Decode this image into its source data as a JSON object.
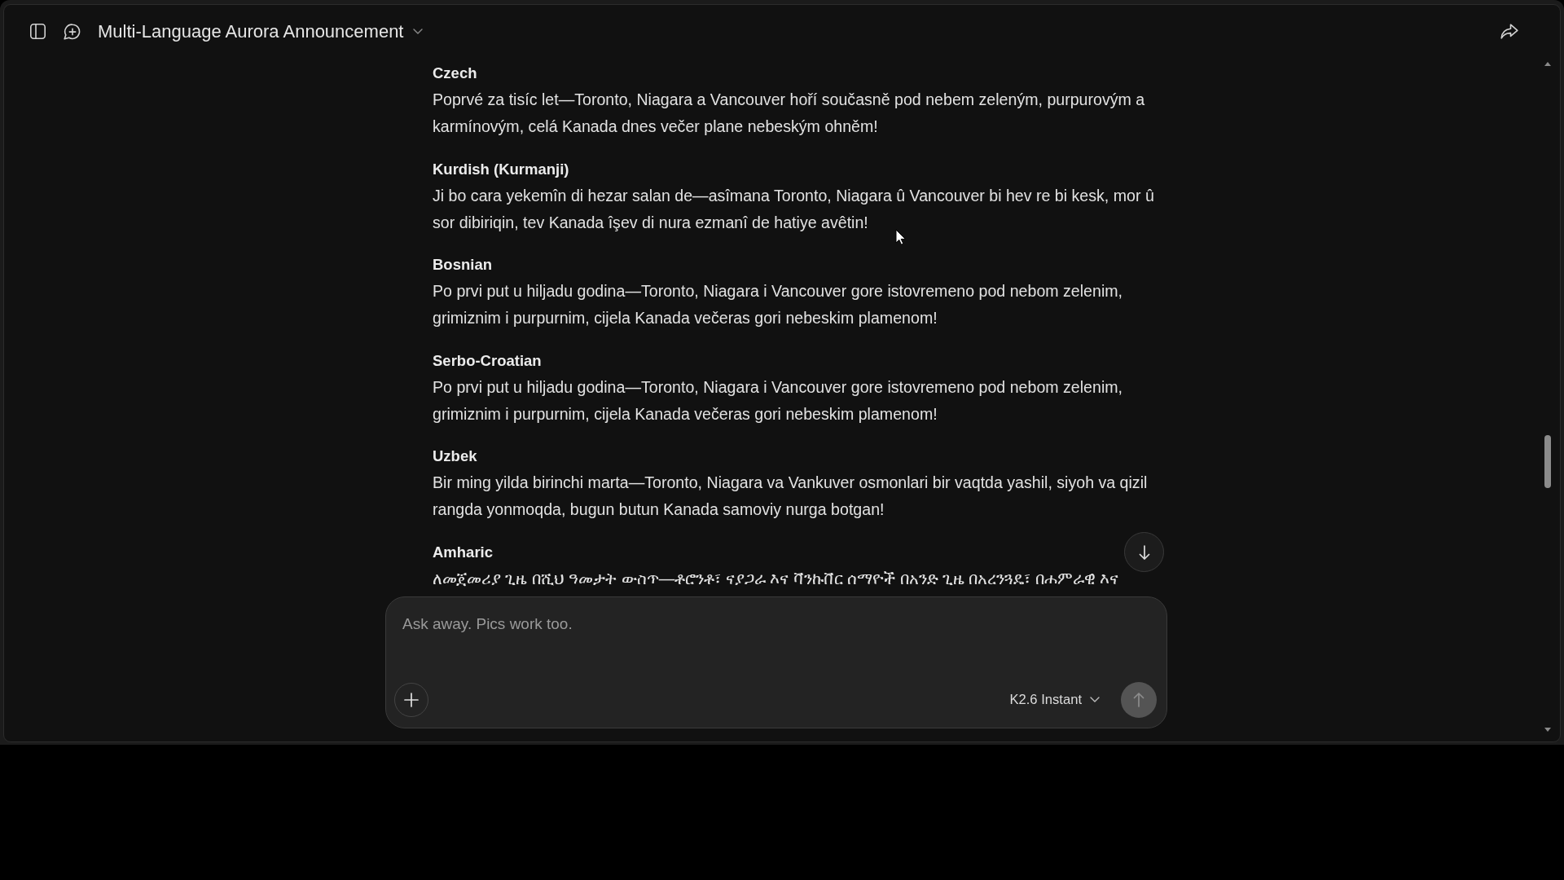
{
  "header": {
    "title": "Multi-Language Aurora Announcement"
  },
  "translations": [
    {
      "language": "Czech",
      "text": "Poprvé za tisíc let—Toronto, Niagara a Vancouver hoří současně pod nebem zeleným, purpurovým a karmínovým, celá Kanada dnes večer plane nebeským ohněm!"
    },
    {
      "language": "Kurdish (Kurmanji)",
      "text": "Ji bo cara yekemîn di hezar salan de—asîmana Toronto, Niagara û Vancouver bi hev re bi kesk, mor û sor dibiriqin, tev Kanada îşev di nura ezmanî de hatiye avêtin!"
    },
    {
      "language": "Bosnian",
      "text": "Po prvi put u hiljadu godina—Toronto, Niagara i Vancouver gore istovremeno pod nebom zelenim, grimiznim i purpurnim, cijela Kanada večeras gori nebeskim plamenom!"
    },
    {
      "language": "Serbo-Croatian",
      "text": "Po prvi put u hiljadu godina—Toronto, Niagara i Vancouver gore istovremeno pod nebom zelenim, grimiznim i purpurnim, cijela Kanada večeras gori nebeskim plamenom!"
    },
    {
      "language": "Uzbek",
      "text": "Bir ming yilda birinchi marta—Toronto, Niagara va Vankuver osmonlari bir vaqtda yashil, siyoh va qizil rangda yonmoqda, bugun butun Kanada samoviy nurga botgan!"
    },
    {
      "language": "Amharic",
      "text": "ለመጀመሪያ ጊዜ በሺህ ዓመታት ውስጥ—ቶሮንቶ፣ ናያጋራ እና ቫንኩቨር ሰማዮች በአንድ ጊዜ በአረንጓዴ፣ በሐምራዊ እና"
    }
  ],
  "composer": {
    "placeholder": "Ask away. Pics work too.",
    "model": "K2.6 Instant"
  }
}
